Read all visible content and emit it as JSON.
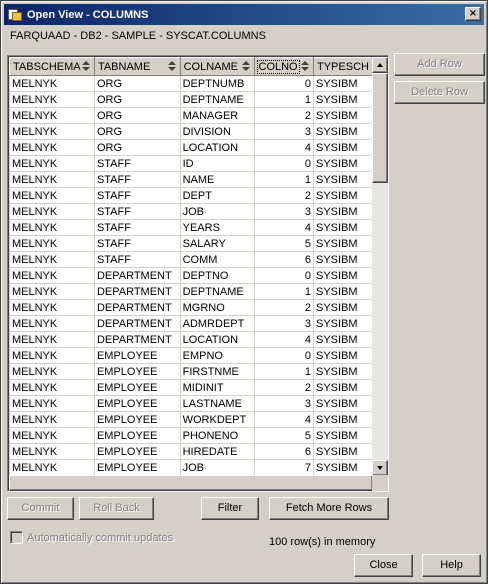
{
  "window": {
    "title": "Open View - COLUMNS",
    "close_glyph": "×",
    "subtitle": "FARQUAAD - DB2 - SAMPLE - SYSCAT.COLUMNS"
  },
  "grid": {
    "columns": [
      "TABSCHEMA",
      "TABNAME",
      "COLNAME",
      "COLNO",
      "TYPESCH"
    ],
    "selected_column": "COLNO",
    "rows": [
      [
        "MELNYK",
        "ORG",
        "DEPTNUMB",
        "0",
        "SYSIBM"
      ],
      [
        "MELNYK",
        "ORG",
        "DEPTNAME",
        "1",
        "SYSIBM"
      ],
      [
        "MELNYK",
        "ORG",
        "MANAGER",
        "2",
        "SYSIBM"
      ],
      [
        "MELNYK",
        "ORG",
        "DIVISION",
        "3",
        "SYSIBM"
      ],
      [
        "MELNYK",
        "ORG",
        "LOCATION",
        "4",
        "SYSIBM"
      ],
      [
        "MELNYK",
        "STAFF",
        "ID",
        "0",
        "SYSIBM"
      ],
      [
        "MELNYK",
        "STAFF",
        "NAME",
        "1",
        "SYSIBM"
      ],
      [
        "MELNYK",
        "STAFF",
        "DEPT",
        "2",
        "SYSIBM"
      ],
      [
        "MELNYK",
        "STAFF",
        "JOB",
        "3",
        "SYSIBM"
      ],
      [
        "MELNYK",
        "STAFF",
        "YEARS",
        "4",
        "SYSIBM"
      ],
      [
        "MELNYK",
        "STAFF",
        "SALARY",
        "5",
        "SYSIBM"
      ],
      [
        "MELNYK",
        "STAFF",
        "COMM",
        "6",
        "SYSIBM"
      ],
      [
        "MELNYK",
        "DEPARTMENT",
        "DEPTNO",
        "0",
        "SYSIBM"
      ],
      [
        "MELNYK",
        "DEPARTMENT",
        "DEPTNAME",
        "1",
        "SYSIBM"
      ],
      [
        "MELNYK",
        "DEPARTMENT",
        "MGRNO",
        "2",
        "SYSIBM"
      ],
      [
        "MELNYK",
        "DEPARTMENT",
        "ADMRDEPT",
        "3",
        "SYSIBM"
      ],
      [
        "MELNYK",
        "DEPARTMENT",
        "LOCATION",
        "4",
        "SYSIBM"
      ],
      [
        "MELNYK",
        "EMPLOYEE",
        "EMPNO",
        "0",
        "SYSIBM"
      ],
      [
        "MELNYK",
        "EMPLOYEE",
        "FIRSTNME",
        "1",
        "SYSIBM"
      ],
      [
        "MELNYK",
        "EMPLOYEE",
        "MIDINIT",
        "2",
        "SYSIBM"
      ],
      [
        "MELNYK",
        "EMPLOYEE",
        "LASTNAME",
        "3",
        "SYSIBM"
      ],
      [
        "MELNYK",
        "EMPLOYEE",
        "WORKDEPT",
        "4",
        "SYSIBM"
      ],
      [
        "MELNYK",
        "EMPLOYEE",
        "PHONENO",
        "5",
        "SYSIBM"
      ],
      [
        "MELNYK",
        "EMPLOYEE",
        "HIREDATE",
        "6",
        "SYSIBM"
      ],
      [
        "MELNYK",
        "EMPLOYEE",
        "JOB",
        "7",
        "SYSIBM"
      ]
    ]
  },
  "side_buttons": {
    "add_row": "Add Row",
    "delete_row": "Delete Row"
  },
  "bottom_buttons": {
    "commit": "Commit",
    "roll_back": "Roll Back",
    "filter": "Filter",
    "fetch_more_rows": "Fetch More Rows"
  },
  "options": {
    "auto_commit_label": "Automatically commit updates",
    "auto_commit_checked": false
  },
  "status": {
    "rows_in_memory": "100 row(s) in memory"
  },
  "dialog_buttons": {
    "close": "Close",
    "help": "Help"
  }
}
